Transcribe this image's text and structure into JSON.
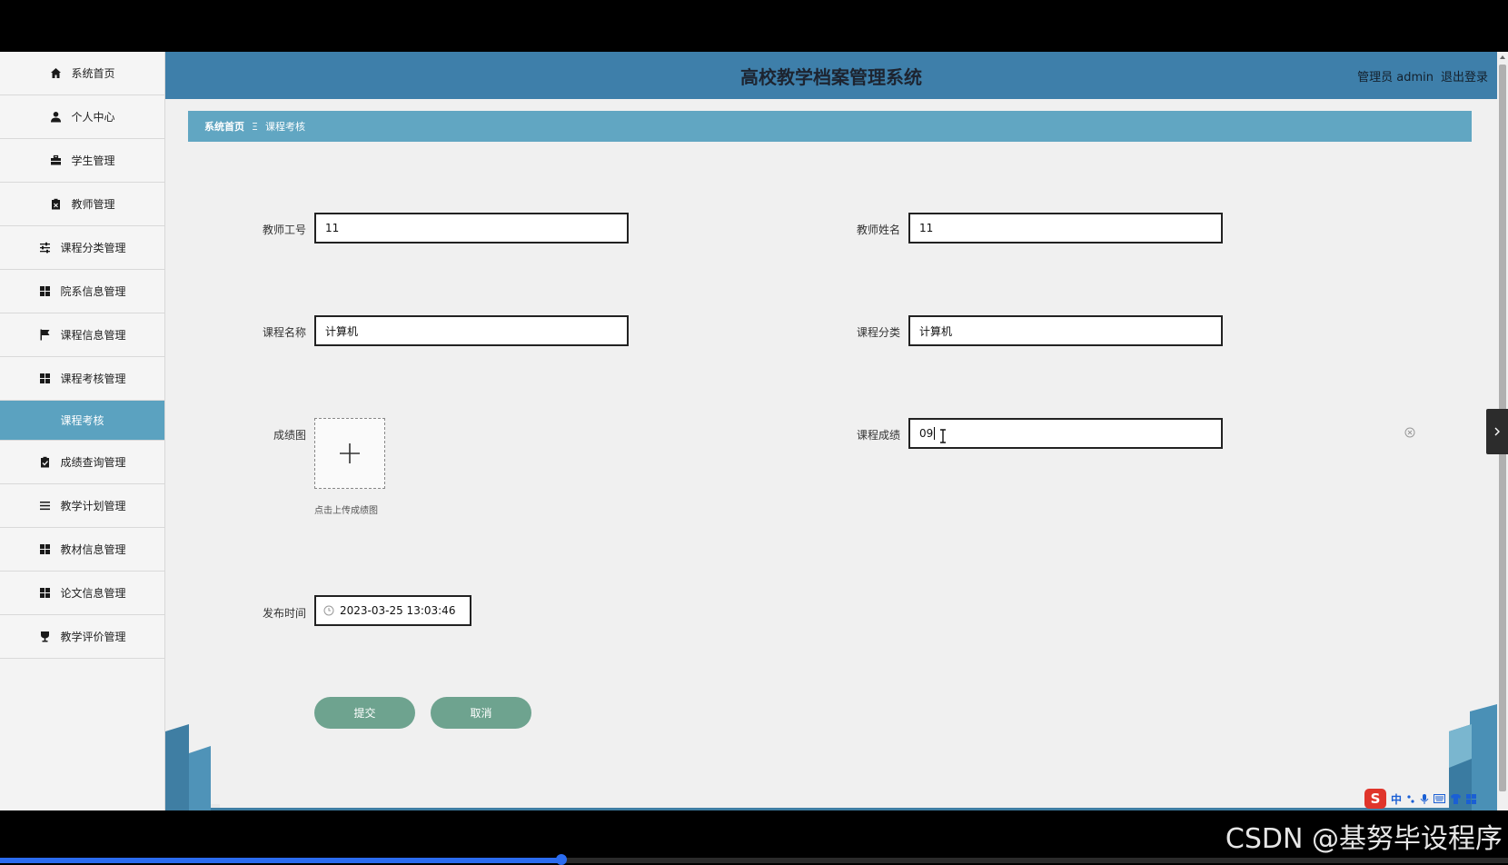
{
  "app": {
    "title": "高校教学档案管理系统",
    "user_label": "管理员 admin",
    "logout_label": "退出登录"
  },
  "sidebar": {
    "items": [
      {
        "label": "系统首页",
        "icon": "home-icon"
      },
      {
        "label": "个人中心",
        "icon": "user-icon"
      },
      {
        "label": "学生管理",
        "icon": "briefcase-icon"
      },
      {
        "label": "教师管理",
        "icon": "clipboard-icon"
      },
      {
        "label": "课程分类管理",
        "icon": "sliders-icon"
      },
      {
        "label": "院系信息管理",
        "icon": "grid-icon"
      },
      {
        "label": "课程信息管理",
        "icon": "flag-icon"
      },
      {
        "label": "课程考核管理",
        "icon": "grid-icon"
      }
    ],
    "active_sub": "课程考核",
    "items_after": [
      {
        "label": "成绩查询管理",
        "icon": "check-clipboard-icon"
      },
      {
        "label": "教学计划管理",
        "icon": "list-icon"
      },
      {
        "label": "教材信息管理",
        "icon": "grid-icon"
      },
      {
        "label": "论文信息管理",
        "icon": "grid-icon"
      },
      {
        "label": "教学评价管理",
        "icon": "trophy-icon"
      }
    ]
  },
  "breadcrumb": {
    "home": "系统首页",
    "separator": "Ξ",
    "current": "课程考核"
  },
  "form": {
    "teacher_id_label": "教师工号",
    "teacher_id_value": "11",
    "teacher_name_label": "教师姓名",
    "teacher_name_value": "11",
    "course_name_label": "课程名称",
    "course_name_value": "计算机",
    "course_category_label": "课程分类",
    "course_category_value": "计算机",
    "score_image_label": "成绩图",
    "upload_hint": "点击上传成绩图",
    "course_score_label": "课程成绩",
    "course_score_value": "09",
    "publish_time_label": "发布时间",
    "publish_time_value": "2023-03-25 13:03:46",
    "submit_label": "提交",
    "cancel_label": "取消"
  },
  "ime": {
    "logo": "S",
    "mode": "中"
  },
  "watermark": "CSDN @基努毕设程序",
  "video_progress_fraction": 0.372,
  "colors": {
    "header": "#3e7faa",
    "breadcrumb": "#61a6c2",
    "active_sub": "#5ba2c0",
    "button": "#6ea38f"
  }
}
